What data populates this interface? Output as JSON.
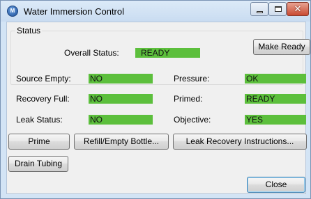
{
  "window": {
    "title": "Water Immersion Control",
    "icon": "water-immersion-app-icon",
    "icon_text": "M"
  },
  "status_group": {
    "label": "Status",
    "overall_label": "Overall Status:",
    "overall_value": "READY",
    "make_ready_label": "Make Ready"
  },
  "indicators": {
    "source_empty": {
      "label": "Source Empty:",
      "value": "NO"
    },
    "recovery_full": {
      "label": "Recovery Full:",
      "value": "NO"
    },
    "leak_status": {
      "label": "Leak Status:",
      "value": "NO"
    },
    "pressure": {
      "label": "Pressure:",
      "value": "OK"
    },
    "primed": {
      "label": "Primed:",
      "value": "READY"
    },
    "objective": {
      "label": "Objective:",
      "value": "YES"
    }
  },
  "buttons": {
    "prime": "Prime",
    "refill": "Refill/Empty Bottle...",
    "leak_recovery": "Leak Recovery Instructions...",
    "drain": "Drain Tubing",
    "close": "Close"
  },
  "colors": {
    "status_green": "#5cbf3c",
    "close_button_red": "#c94a32",
    "titlebar_blue": "#c9dcf1"
  }
}
